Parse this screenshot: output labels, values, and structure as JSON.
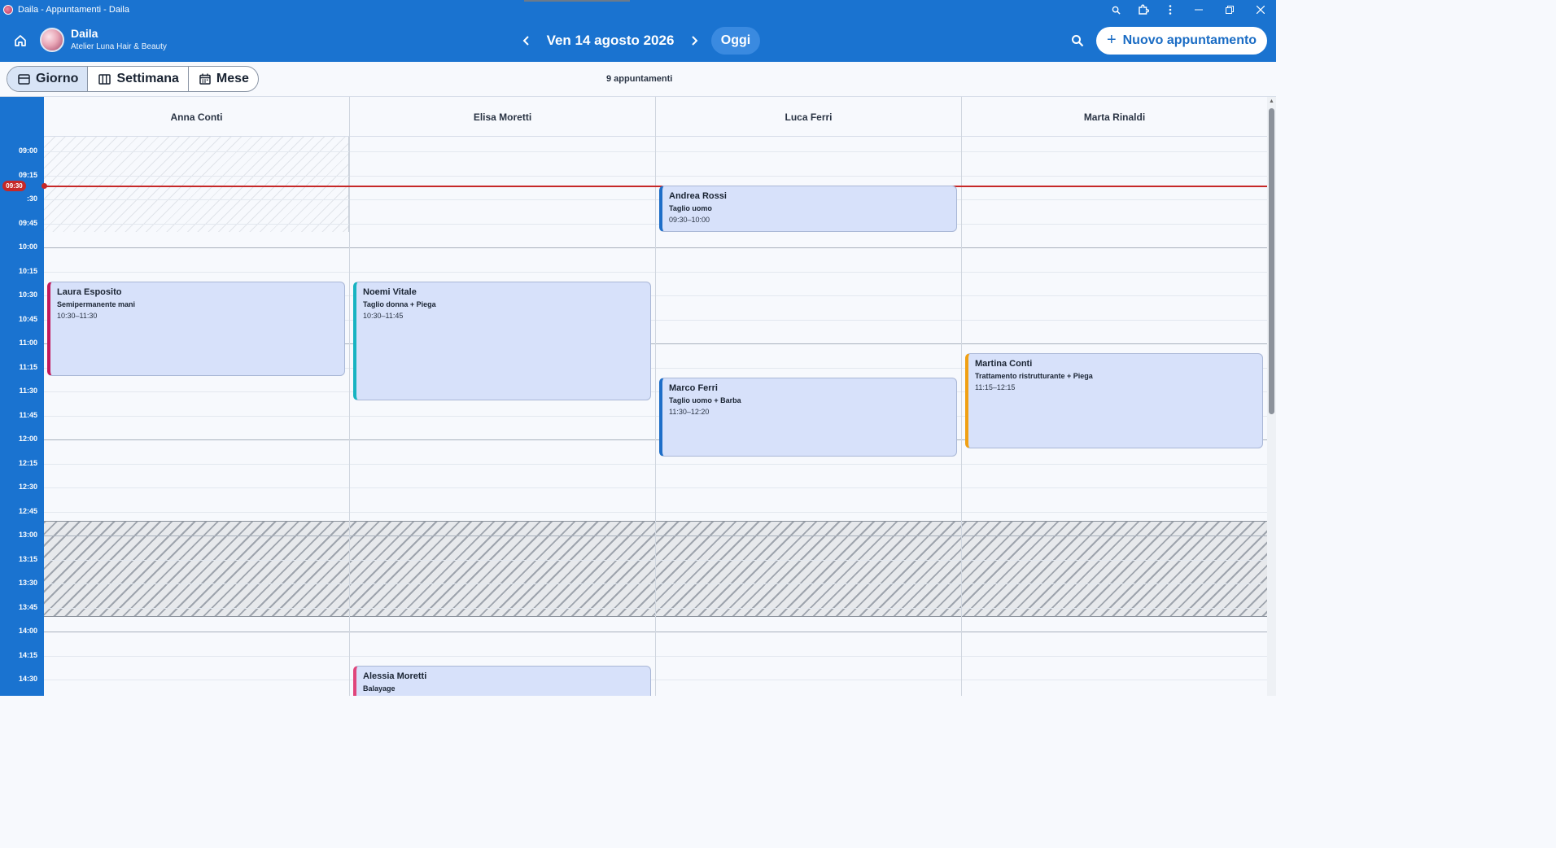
{
  "window": {
    "title": "Daila - Appuntamenti - Daila"
  },
  "header": {
    "brand_name": "Daila",
    "brand_subtitle": "Atelier Luna Hair & Beauty",
    "date_label": "Ven 14 agosto 2026",
    "today_label": "Oggi",
    "new_appointment_label": "Nuovo appuntamento"
  },
  "toolbar": {
    "views": [
      {
        "label": "Giorno",
        "active": true
      },
      {
        "label": "Settimana",
        "active": false
      },
      {
        "label": "Mese",
        "active": false
      }
    ],
    "appointment_count": "9 appuntamenti"
  },
  "calendar": {
    "now_label": "09:30",
    "time_labels": [
      "09:00",
      "09:15",
      ":30",
      "09:45",
      "10:00",
      "10:15",
      "10:30",
      "10:45",
      "11:00",
      "11:15",
      "11:30",
      "11:45",
      "12:00",
      "12:15",
      "12:30",
      "12:45",
      "13:00",
      "13:15",
      "13:30",
      "13:45",
      "14:00",
      "14:15",
      "14:30",
      "14:45"
    ],
    "staff": [
      "Anna Conti",
      "Elisa Moretti",
      "Luca Ferri",
      "Marta Rinaldi"
    ],
    "appointments": [
      {
        "staff_index": 2,
        "client": "Andrea Rossi",
        "service": "Taglio uomo",
        "time": "09:30–10:00",
        "color": "#1e6ec8"
      },
      {
        "staff_index": 0,
        "client": "Laura Esposito",
        "service": "Semipermanente mani",
        "time": "10:30–11:30",
        "color": "#c2185b"
      },
      {
        "staff_index": 1,
        "client": "Noemi Vitale",
        "service": "Taglio donna + Piega",
        "time": "10:30–11:45",
        "color": "#17b3c1"
      },
      {
        "staff_index": 3,
        "client": "Martina Conti",
        "service": "Trattamento ristrutturante + Piega",
        "time": "11:15–12:15",
        "color": "#f0a013"
      },
      {
        "staff_index": 2,
        "client": "Marco Ferri",
        "service": "Taglio uomo + Barba",
        "time": "11:30–12:20",
        "color": "#1e6ec8"
      },
      {
        "staff_index": 1,
        "client": "Alessia Moretti",
        "service": "Balayage",
        "time": "",
        "color": "#e0457b"
      }
    ]
  }
}
